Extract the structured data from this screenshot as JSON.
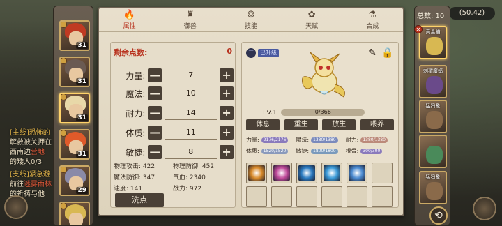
{
  "hud": {
    "coords": "(50,42)",
    "quest_lines": [
      {
        "segments": [
          {
            "text": "[主线]恐怖的",
            "cls": "gold"
          }
        ]
      },
      {
        "segments": [
          {
            "text": "解救被关押在",
            "cls": ""
          }
        ]
      },
      {
        "segments": [
          {
            "text": "西南边",
            "cls": ""
          },
          {
            "text": "营地",
            "cls": "red"
          }
        ]
      },
      {
        "segments": [
          {
            "text": "的矮人0/3",
            "cls": ""
          }
        ]
      },
      {
        "segments": [
          {
            "text": "[支线]紧急避",
            "cls": "gold"
          }
        ]
      },
      {
        "segments": [
          {
            "text": "前往",
            "cls": ""
          },
          {
            "text": "迷雾雨林",
            "cls": "red"
          }
        ]
      },
      {
        "segments": [
          {
            "text": "的祈祷与他",
            "cls": ""
          }
        ]
      }
    ]
  },
  "roster": {
    "heroes": [
      {
        "level": "31",
        "hair": "#c03a22",
        "active": false
      },
      {
        "level": "31",
        "hair": "#6a5a52",
        "active": false
      },
      {
        "level": "31",
        "hair": "#e8d8a8",
        "active": true
      },
      {
        "level": "31",
        "hair": "#e05a2a",
        "active": false
      },
      {
        "level": "29",
        "hair": "#8a8aa8",
        "active": false
      },
      {
        "level": "",
        "hair": "#d8b852",
        "active": false
      }
    ]
  },
  "tabs": [
    {
      "label": "属性",
      "icon": "🔥",
      "active": true
    },
    {
      "label": "御兽",
      "icon": "♜",
      "active": false
    },
    {
      "label": "技能",
      "icon": "❂",
      "active": false
    },
    {
      "label": "天赋",
      "icon": "✿",
      "active": false
    },
    {
      "label": "合成",
      "icon": "⚗",
      "active": false
    }
  ],
  "stats": {
    "remaining_label": "剩余点数:",
    "remaining_value": "0",
    "rows": [
      {
        "name": "力量:",
        "value": "7"
      },
      {
        "name": "魔法:",
        "value": "10"
      },
      {
        "name": "耐力:",
        "value": "14"
      },
      {
        "name": "体质:",
        "value": "11"
      },
      {
        "name": "敏捷:",
        "value": "8"
      }
    ],
    "minus": "—",
    "plus": "+",
    "derived": [
      "物理攻击: 422",
      "物理防御: 452",
      "魔法防御: 347",
      "气血: 2340",
      "速度: 141",
      "战力: 972"
    ],
    "wash_label": "洗点"
  },
  "pet": {
    "info_icon": "☰",
    "info_badge": "已升级",
    "level": "Lv.1",
    "exp": "0/366",
    "exp_fraction": 0.0,
    "actions": [
      "休息",
      "重生",
      "放生",
      "喂养"
    ],
    "attrs": [
      {
        "label": "力量:",
        "bar": "2176/2176",
        "color": "#8a7abc"
      },
      {
        "label": "魔法:",
        "bar": "1380/1380",
        "color": "#7a8abc"
      },
      {
        "label": "耐力:",
        "bar": "1380/1380",
        "color": "#bc8a7a"
      },
      {
        "label": "体质:",
        "bar": "1520/1520",
        "color": "#8a9abc"
      },
      {
        "label": "敏捷:",
        "bar": "1800/1800",
        "color": "#7a9abc"
      },
      {
        "label": "根骨:",
        "bar": "300/300",
        "color": "#8a7abc"
      }
    ],
    "skills": [
      "#d88a2a",
      "#c04a9a",
      "#2a7ac0",
      "#3a9ad8",
      "#4a8ad0",
      "",
      "",
      "",
      "",
      "",
      "",
      ""
    ]
  },
  "right_col": {
    "total_label": "总数: 10",
    "pets": [
      {
        "label": "黄金猫",
        "color": "#d8b852",
        "active": true
      },
      {
        "label": "刺猬魔蝠",
        "color": "#6a4a8a",
        "active": false
      },
      {
        "label": "猛犸象",
        "color": "#8a6a4a",
        "active": false
      },
      {
        "label": "",
        "color": "#4a8a5a",
        "active": false
      },
      {
        "label": "猛犸象",
        "color": "#8a6a4a",
        "active": false
      }
    ]
  }
}
